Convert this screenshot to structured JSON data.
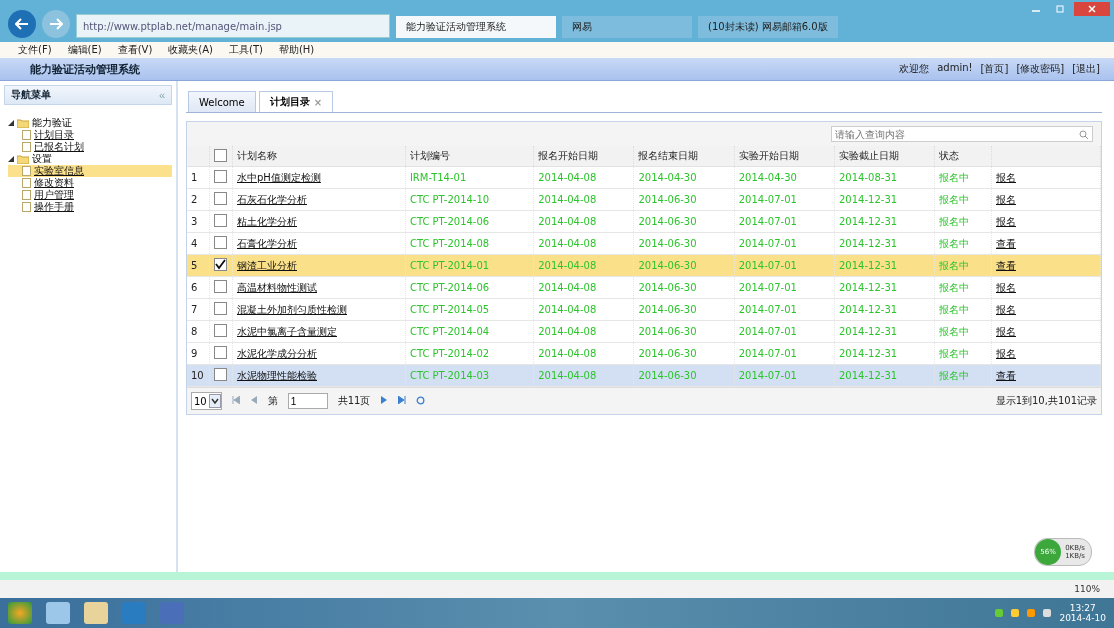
{
  "browser": {
    "url": "http://www.ptplab.net/manage/main.jsp",
    "tabs": [
      {
        "label": "能力验证活动管理系统",
        "selected": true
      },
      {
        "label": "网易",
        "selected": false
      },
      {
        "label": "(10封未读) 网易邮箱6.0版",
        "selected": false
      }
    ],
    "menu": [
      "文件(F)",
      "编辑(E)",
      "查看(V)",
      "收藏夹(A)",
      "工具(T)",
      "帮助(H)"
    ]
  },
  "header": {
    "title": "能力验证活动管理系统",
    "welcome": "欢迎您",
    "user": "admin!",
    "links": [
      "[首页]",
      "[修改密码]",
      "[退出]"
    ]
  },
  "sidebar": {
    "title": "导航菜单",
    "collapse": "«",
    "items": [
      {
        "label": "能力验证",
        "expanded": true,
        "children": [
          {
            "label": "计划目录",
            "selected": false
          },
          {
            "label": "已报名计划",
            "selected": false
          }
        ]
      },
      {
        "label": "设置",
        "expanded": true,
        "children": [
          {
            "label": "实验室信息",
            "selected": true
          },
          {
            "label": "修改资料",
            "selected": false
          },
          {
            "label": "用户管理",
            "selected": false
          },
          {
            "label": "操作手册",
            "selected": false
          }
        ]
      }
    ]
  },
  "tabs": [
    {
      "label": "Welcome",
      "selected": false
    },
    {
      "label": "计划目录",
      "selected": true,
      "close": "×"
    }
  ],
  "search": {
    "placeholder": "请输入查询内容"
  },
  "table": {
    "select_all_checked": false,
    "columns": [
      "计划名称",
      "计划编号",
      "报名开始日期",
      "报名结束日期",
      "实验开始日期",
      "实验截止日期",
      "状态"
    ],
    "rows": [
      {
        "index": "1",
        "checked": false,
        "selected": false,
        "hovered": false,
        "cells": [
          "水中pH值测定检测",
          "IRM-T14-01",
          "2014-04-08",
          "2014-04-30",
          "2014-04-30",
          "2014-08-31",
          "报名中",
          "报名"
        ]
      },
      {
        "index": "2",
        "checked": false,
        "selected": false,
        "hovered": false,
        "cells": [
          "石灰石化学分析",
          "CTC PT-2014-10",
          "2014-04-08",
          "2014-06-30",
          "2014-07-01",
          "2014-12-31",
          "报名中",
          "报名"
        ]
      },
      {
        "index": "3",
        "checked": false,
        "selected": false,
        "hovered": false,
        "cells": [
          "粘土化学分析",
          "CTC PT-2014-06",
          "2014-04-08",
          "2014-06-30",
          "2014-07-01",
          "2014-12-31",
          "报名中",
          "报名"
        ]
      },
      {
        "index": "4",
        "checked": false,
        "selected": false,
        "hovered": false,
        "cells": [
          "石膏化学分析",
          "CTC PT-2014-08",
          "2014-04-08",
          "2014-06-30",
          "2014-07-01",
          "2014-12-31",
          "报名中",
          "查看"
        ]
      },
      {
        "index": "5",
        "checked": true,
        "selected": true,
        "hovered": false,
        "cells": [
          "钢渣工业分析",
          "CTC PT-2014-01",
          "2014-04-08",
          "2014-06-30",
          "2014-07-01",
          "2014-12-31",
          "报名中",
          "查看"
        ]
      },
      {
        "index": "6",
        "checked": false,
        "selected": false,
        "hovered": false,
        "cells": [
          "高温材料物性测试",
          "CTC PT-2014-06",
          "2014-04-08",
          "2014-06-30",
          "2014-07-01",
          "2014-12-31",
          "报名中",
          "报名"
        ]
      },
      {
        "index": "7",
        "checked": false,
        "selected": false,
        "hovered": false,
        "cells": [
          "混凝土外加剂匀质性检测",
          "CTC PT-2014-05",
          "2014-04-08",
          "2014-06-30",
          "2014-07-01",
          "2014-12-31",
          "报名中",
          "报名"
        ]
      },
      {
        "index": "8",
        "checked": false,
        "selected": false,
        "hovered": false,
        "cells": [
          "水泥中氯离子含量测定",
          "CTC PT-2014-04",
          "2014-04-08",
          "2014-06-30",
          "2014-07-01",
          "2014-12-31",
          "报名中",
          "报名"
        ]
      },
      {
        "index": "9",
        "checked": false,
        "selected": false,
        "hovered": false,
        "cells": [
          "水泥化学成分分析",
          "CTC PT-2014-02",
          "2014-04-08",
          "2014-06-30",
          "2014-07-01",
          "2014-12-31",
          "报名中",
          "报名"
        ]
      },
      {
        "index": "10",
        "checked": false,
        "selected": false,
        "hovered": true,
        "cells": [
          "水泥物理性能检验",
          "CTC PT-2014-03",
          "2014-04-08",
          "2014-06-30",
          "2014-07-01",
          "2014-12-31",
          "报名中",
          "查看"
        ]
      }
    ]
  },
  "pager": {
    "page_size": "10",
    "page_label": "第",
    "page": "1",
    "pages": "共11页",
    "summary": "显示1到10,共101记录"
  },
  "speed": {
    "percent": "56%",
    "up": "0KB/s",
    "down": "1KB/s"
  },
  "status_bar": {
    "zoom": "110%"
  },
  "taskbar": {
    "time": "13:27",
    "date": "2014-4-10"
  }
}
